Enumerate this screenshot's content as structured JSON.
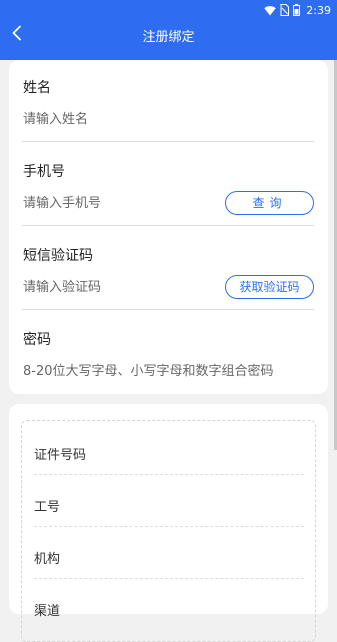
{
  "status_bar": {
    "time": "2:39",
    "icons": [
      "wifi-icon",
      "sim-icon",
      "battery-icon"
    ]
  },
  "header": {
    "title": "注册绑定",
    "back_icon": "chevron-left-icon",
    "background_color": "#2f6df0"
  },
  "form": {
    "name": {
      "label": "姓名",
      "placeholder": "请输入姓名"
    },
    "phone": {
      "label": "手机号",
      "placeholder": "请输入手机号",
      "button_label": "查询"
    },
    "sms_code": {
      "label": "短信验证码",
      "placeholder": "请输入验证码",
      "button_label": "获取验证码"
    },
    "password": {
      "label": "密码",
      "placeholder": "8-20位大写字母、小写字母和数字组合密码"
    }
  },
  "details_panel": {
    "rows": [
      {
        "label": "证件号码"
      },
      {
        "label": "工号"
      },
      {
        "label": "机构"
      },
      {
        "label": "渠道"
      }
    ]
  },
  "colors": {
    "accent": "#2f6df0",
    "page_background": "#f1f1f1",
    "card_background": "#ffffff"
  }
}
